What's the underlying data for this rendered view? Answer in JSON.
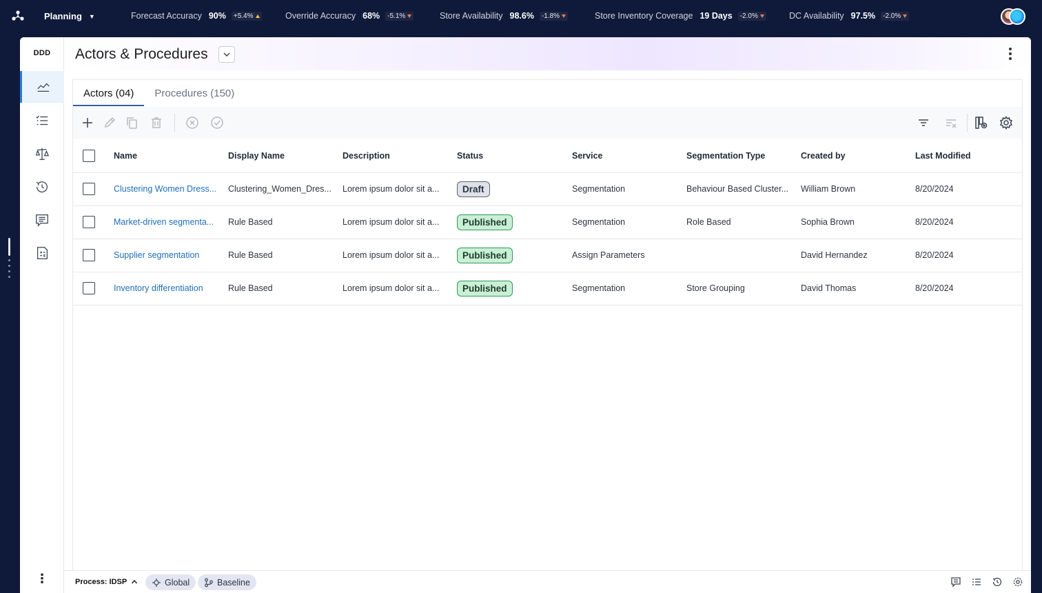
{
  "topbar": {
    "module": "Planning",
    "kpis": [
      {
        "label": "Forecast Accuracy",
        "value": "90%",
        "delta": "+5.4%",
        "direction": "up"
      },
      {
        "label": "Override Accuracy",
        "value": "68%",
        "delta": "-5.1%",
        "direction": "down"
      },
      {
        "label": "Store Availability",
        "value": "98.6%",
        "delta": "-1.8%",
        "direction": "down"
      },
      {
        "label": "Store Inventory Coverage",
        "value": "19 Days",
        "delta": "-2.0%",
        "direction": "down"
      },
      {
        "label": "DC Availability",
        "value": "97.5%",
        "delta": "-2.0%",
        "direction": "down"
      }
    ]
  },
  "sidebar": {
    "brand": "DDD",
    "items": [
      {
        "icon": "trend-chart-icon",
        "active": true
      },
      {
        "icon": "checklist-icon",
        "active": false
      },
      {
        "icon": "balance-scale-icon",
        "active": false
      },
      {
        "icon": "history-icon",
        "active": false
      },
      {
        "icon": "comments-icon",
        "active": false
      },
      {
        "icon": "calculator-document-icon",
        "active": false
      }
    ]
  },
  "header": {
    "title": "Actors & Procedures"
  },
  "tabs": [
    {
      "label": "Actors (04)",
      "active": true
    },
    {
      "label": "Procedures (150)",
      "active": false
    }
  ],
  "table": {
    "columns": [
      "Name",
      "Display Name",
      "Description",
      "Status",
      "Service",
      "Segmentation Type",
      "Created by",
      "Last Modified"
    ],
    "rows": [
      {
        "name": "Clustering Women Dress...",
        "display_name": "Clustering_Women_Dres...",
        "description": "Lorem ipsum dolor sit a...",
        "status": "Draft",
        "service": "Segmentation",
        "segmentation_type": "Behaviour Based Cluster...",
        "created_by": "William Brown",
        "last_modified": "8/20/2024"
      },
      {
        "name": "Market-driven segmenta...",
        "display_name": "Rule Based",
        "description": "Lorem ipsum dolor sit a...",
        "status": "Published",
        "service": "Segmentation",
        "segmentation_type": "Role Based",
        "created_by": "Sophia Brown",
        "last_modified": "8/20/2024"
      },
      {
        "name": "Supplier segmentation",
        "display_name": "Rule Based",
        "description": "Lorem ipsum dolor sit a...",
        "status": "Published",
        "service": "Assign Parameters",
        "segmentation_type": "",
        "created_by": "David Hernandez",
        "last_modified": "8/20/2024"
      },
      {
        "name": "Inventory differentiation",
        "display_name": "Rule Based",
        "description": "Lorem ipsum dolor sit a...",
        "status": "Published",
        "service": "Segmentation",
        "segmentation_type": "Store Grouping",
        "created_by": "David Thomas",
        "last_modified": "8/20/2024"
      }
    ]
  },
  "footer": {
    "process": "Process: IDSP",
    "chips": [
      "Global",
      "Baseline"
    ]
  },
  "colors": {
    "topbar_bg": "#0f1a3a",
    "link": "#1e6fb8",
    "draft_bg": "#dfe2e8",
    "published_bg": "#c9efd6",
    "published_border": "#2f9b55",
    "active_nav": "#eaf2fb"
  }
}
